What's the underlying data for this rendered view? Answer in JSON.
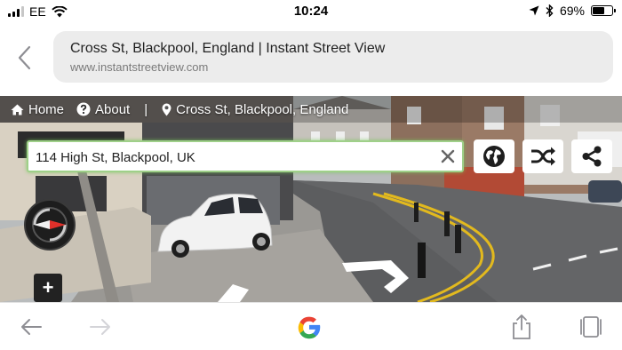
{
  "status_bar": {
    "carrier": "EE",
    "time": "10:24",
    "battery_percent": "69%",
    "battery_level": 0.69,
    "icons": [
      "signal-icon",
      "wifi-icon",
      "location-arrow-icon",
      "bluetooth-icon",
      "battery-icon"
    ]
  },
  "browser": {
    "page_title": "Cross St, Blackpool, England | Instant Street View",
    "domain": "www.instantstreetview.com"
  },
  "site_nav": {
    "home": "Home",
    "about": "About",
    "separator": "|",
    "location": "Cross St, Blackpool, England"
  },
  "search": {
    "value": "114 High St, Blackpool, UK"
  },
  "controls": {
    "zoom_in": "+",
    "buttons": [
      "globe-icon",
      "shuffle-icon",
      "share-icon"
    ]
  },
  "toolbar": {
    "icons": [
      "back-arrow-icon",
      "forward-arrow-icon",
      "google-icon",
      "share-icon",
      "tabs-icon"
    ]
  },
  "colors": {
    "search_border": "#9fd089",
    "compass_red": "#e0302a",
    "road_line_yellow": "#e2b91e",
    "google_blue": "#4285f4",
    "google_red": "#ea4335",
    "google_yellow": "#fbbc05",
    "google_green": "#34a853"
  }
}
